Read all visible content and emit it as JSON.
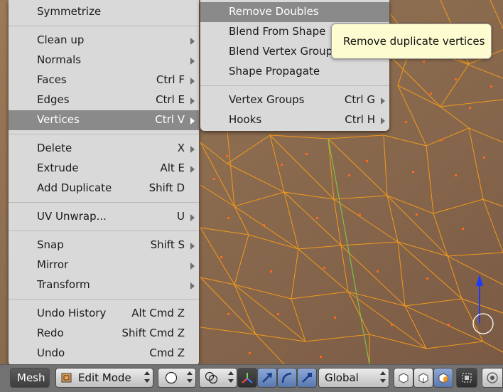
{
  "main_menu": {
    "items": [
      {
        "label": "Symmetrize",
        "shortcut": "",
        "arrow": false
      },
      {
        "label": "Clean up",
        "shortcut": "",
        "arrow": true
      },
      {
        "label": "Normals",
        "shortcut": "",
        "arrow": true
      },
      {
        "label": "Faces",
        "shortcut": "Ctrl F",
        "arrow": true
      },
      {
        "label": "Edges",
        "shortcut": "Ctrl E",
        "arrow": true
      },
      {
        "label": "Vertices",
        "shortcut": "Ctrl V",
        "arrow": true
      },
      {
        "label": "Delete",
        "shortcut": "X",
        "arrow": true
      },
      {
        "label": "Extrude",
        "shortcut": "Alt E",
        "arrow": true
      },
      {
        "label": "Add Duplicate",
        "shortcut": "Shift D",
        "arrow": false
      },
      {
        "label": "UV Unwrap...",
        "shortcut": "U",
        "arrow": true
      },
      {
        "label": "Snap",
        "shortcut": "Shift S",
        "arrow": true
      },
      {
        "label": "Mirror",
        "shortcut": "",
        "arrow": true
      },
      {
        "label": "Transform",
        "shortcut": "",
        "arrow": true
      },
      {
        "label": "Undo History",
        "shortcut": "Alt Cmd Z",
        "arrow": false
      },
      {
        "label": "Redo",
        "shortcut": "Shift Cmd Z",
        "arrow": false
      },
      {
        "label": "Undo",
        "shortcut": "Cmd Z",
        "arrow": false
      }
    ]
  },
  "sub_menu": {
    "items": [
      {
        "label": "Remove Doubles",
        "shortcut": "",
        "arrow": false
      },
      {
        "label": "Blend From Shape",
        "shortcut": "",
        "arrow": false
      },
      {
        "label": "Blend Vertex Group",
        "shortcut": "",
        "arrow": false
      },
      {
        "label": "Shape Propagate",
        "shortcut": "",
        "arrow": false
      },
      {
        "label": "Vertex Groups",
        "shortcut": "Ctrl G",
        "arrow": true
      },
      {
        "label": "Hooks",
        "shortcut": "Ctrl H",
        "arrow": true
      }
    ]
  },
  "tooltip": {
    "text": "Remove duplicate vertices"
  },
  "header": {
    "menu_label": "Mesh",
    "mode_label": "Edit Mode",
    "orientation_label": "Global"
  },
  "colors": {
    "viewport_bg": "#8a6a50",
    "wire": "#f29a1c",
    "menu_bg": "#d9d9d9",
    "menu_active": "#8a8a8a",
    "tooltip_bg": "#fcfcd0"
  }
}
